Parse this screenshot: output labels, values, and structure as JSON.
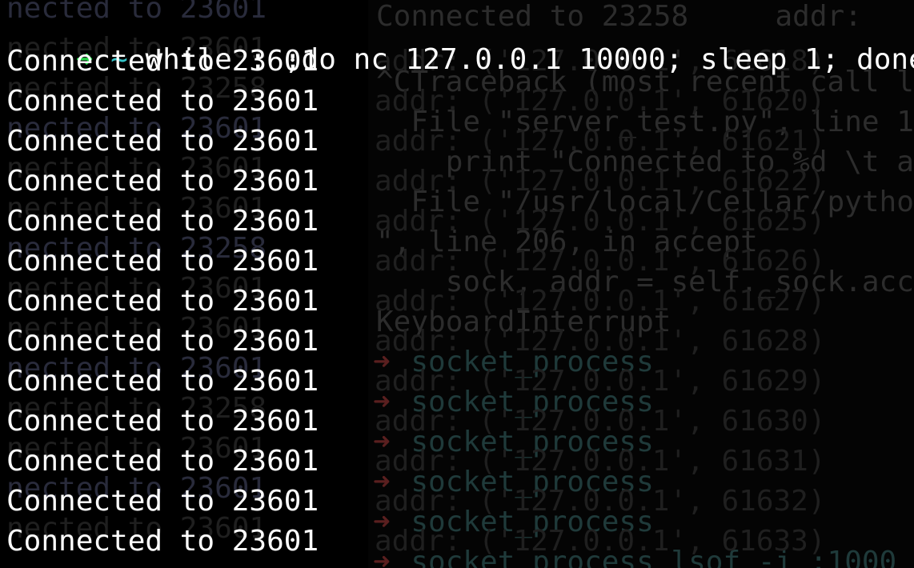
{
  "prompt": {
    "arrow": "➜",
    "cwd": "~",
    "command": "while : ;do nc 127.0.0.1 10000; sleep 1; done;"
  },
  "output_lines": [
    "Connected to 23601",
    "Connected to 23601",
    "Connected to 23601",
    "Connected to 23601",
    "Connected to 23601",
    "Connected to 23601",
    "Connected to 23601",
    "Connected to 23601",
    "Connected to 23601",
    "Connected to 23601",
    "Connected to 23601",
    "Connected to 23601",
    "Connected to 23601"
  ],
  "ghost_left": {
    "text": "nected to 23601",
    "alt": "nected to 23258"
  },
  "ghost_right": {
    "lines": [
      "Connected to 23258     addr:",
      "^CTraceback (most recent call l",
      "  File \"server_test.py\", line 1",
      "    print \"Connected to %d \\t a",
      "  File \"/usr/local/Cellar/pytho",
      "\", line 206, in accept",
      "    sock, addr = self._sock.acc",
      "KeyboardInterrupt",
      "  socket_process",
      "  socket_process",
      "  socket_process",
      "  socket_process",
      "  socket_process",
      "  socket_process lsof -i :1000"
    ],
    "addr_lines": [
      "addr: ('127.0.0.1', 61618)",
      "addr: ('127.0.0.1', 61620)",
      "addr: ('127.0.0.1', 61621)",
      "addr: ('127.0.0.1', 61622)",
      "addr: ('127.0.0.1', 61625)",
      "addr: ('127.0.0.1', 61626)",
      "addr: ('127.0.0.1', 61627)",
      "addr: ('127.0.0.1', 61628)",
      "addr: ('127.0.0.1', 61629)",
      "addr: ('127.0.0.1', 61630)",
      "addr: ('127.0.0.1', 61631)",
      "addr: ('127.0.0.1', 61632)",
      "addr: ('127.0.0.1', 61633)"
    ],
    "arrow": "➜"
  },
  "colors": {
    "background": "#000000",
    "foreground": "#ffffff",
    "prompt_arrow": "#27d64a",
    "prompt_cwd": "#34c3c7"
  }
}
